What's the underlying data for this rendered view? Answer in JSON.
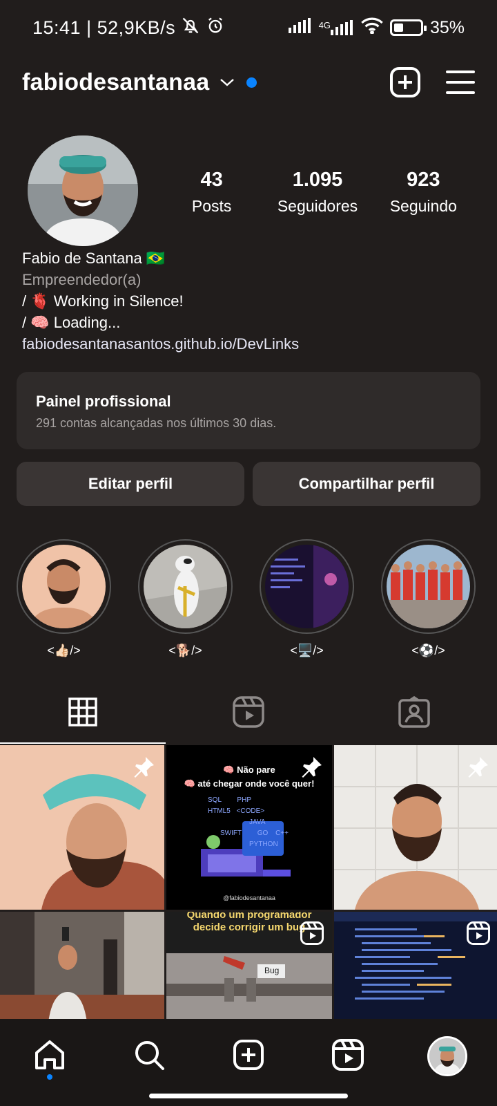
{
  "status_bar": {
    "time": "15:41",
    "net_speed": "52,9KB/s",
    "network": "4G",
    "battery": "35%",
    "battery_level": 0.35
  },
  "header": {
    "username": "fabiodesantanaa",
    "accent_color": "#0a84ff"
  },
  "profile": {
    "stats": [
      {
        "value": "43",
        "label": "Posts"
      },
      {
        "value": "1.095",
        "label": "Seguidores"
      },
      {
        "value": "923",
        "label": "Seguindo"
      }
    ],
    "name": "Fabio de Santana 🇧🇷",
    "category": "Empreendedor(a)",
    "bio_line1": "/ 🫀 Working in Silence!",
    "bio_line2": "/ 🧠 Loading...",
    "link": "fabiodesantanasantos.github.io/DevLinks"
  },
  "dashboard": {
    "title": "Painel profissional",
    "subtitle": "291 contas alcançadas nos últimos 30 dias."
  },
  "buttons": {
    "edit": "Editar perfil",
    "share": "Compartilhar perfil"
  },
  "highlights": [
    {
      "label": "<👍🏻/>"
    },
    {
      "label": "<🐕/>"
    },
    {
      "label": "<🖥️/>"
    },
    {
      "label": "<⚽/>"
    }
  ],
  "posts": {
    "post2_line1": "🧠 Não pare",
    "post2_line2": "🧠 até chegar onde você quer!",
    "post2_tags": [
      "SQL",
      "PHP",
      "HTML5",
      "<CODE>",
      "JAVA",
      "SWIFT",
      "GO",
      "C++",
      "PYTHON"
    ],
    "post2_handle": "@fabiodesantanaa",
    "post5_caption_1": "Quando um programador",
    "post5_caption_2": "decide corrigir um bug",
    "post5_bug": "Bug"
  },
  "icons": {
    "create": "plus-square-icon",
    "menu": "hamburger-menu-icon",
    "grid_tab": "grid-icon",
    "reels_tab": "reels-icon",
    "tagged_tab": "tagged-user-icon",
    "nav": [
      "home-icon",
      "search-icon",
      "create-icon",
      "reels-icon",
      "profile-avatar"
    ]
  }
}
